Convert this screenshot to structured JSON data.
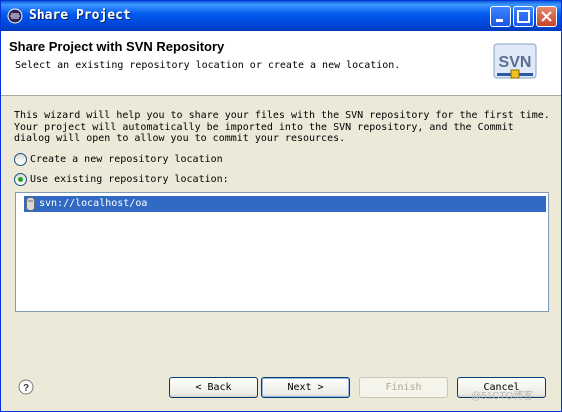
{
  "window": {
    "title": "Share Project",
    "controls": [
      "minimize-icon",
      "maximize-icon",
      "close-icon"
    ]
  },
  "header": {
    "title": "Share Project with SVN Repository",
    "description": "Select an existing repository location or create a new location.",
    "logo_text": "SVN"
  },
  "info_lines": [
    "This wizard will help you to share your files with the SVN repository for the first time.",
    "Your project will automatically be imported into the SVN repository, and the Commit",
    "dialog will open to allow you to commit your resources."
  ],
  "options": {
    "create_new": {
      "label": "Create a new repository location",
      "selected": false
    },
    "use_existing": {
      "label": "Use existing repository location:",
      "selected": true
    }
  },
  "repositories": [
    {
      "url": "svn://localhost/oa",
      "selected": true
    }
  ],
  "buttons": {
    "back": "< Back",
    "next": "Next >",
    "finish": "Finish",
    "cancel": "Cancel"
  },
  "watermark": "@51CTO博客",
  "colors": {
    "selection": "#316ac5",
    "titlebar": "#0058ee",
    "accent_green": "#21a121"
  }
}
